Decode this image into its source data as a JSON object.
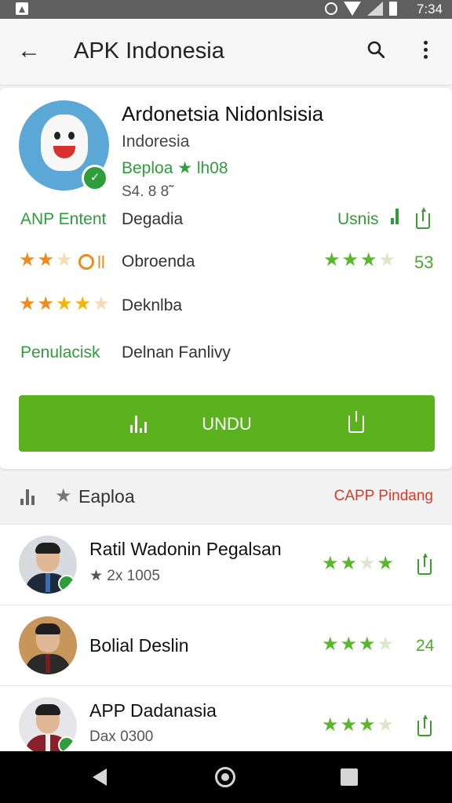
{
  "status_bar": {
    "time": "7:34"
  },
  "app_bar": {
    "title": "APK Indonesia"
  },
  "app": {
    "name": "Ardonetsia Nidonlsisia",
    "developer": "Indoresia",
    "rating_text": "Beploa ★ lh08",
    "size": "S4. 8 8̃",
    "rows": [
      {
        "label": "ANP Entent",
        "value": "Degadia",
        "right_text": "Usnis"
      },
      {
        "label": "",
        "value": "Obroenda",
        "left_number": "ll",
        "right_number": "53"
      },
      {
        "label": "",
        "value": "Deknlba"
      },
      {
        "label": "Penulacisk",
        "value": "Delnan Fanlivy"
      }
    ],
    "download_label": "UNDU"
  },
  "section": {
    "title": "Eaploa",
    "link": "CAPP Pindang"
  },
  "list": [
    {
      "title": "Ratil Wadonin Pegalsan",
      "subtitle": "★ 2x 1005"
    },
    {
      "title": "Bolial Deslin",
      "subtitle": "",
      "number": "24"
    },
    {
      "title": "APP Dadanasia",
      "subtitle": "Dax 0300"
    }
  ],
  "colors": {
    "accent_green": "#5bb21e",
    "link_red": "#d93a2a",
    "star_orange": "#f08a1c",
    "star_green": "#58b82a"
  },
  "icons": [
    "back-arrow-icon",
    "search-icon",
    "more-vert-icon",
    "share-icon",
    "bar-chart-icon",
    "star-icon",
    "verified-badge-icon",
    "nav-back-icon",
    "nav-home-icon",
    "nav-recent-icon"
  ]
}
